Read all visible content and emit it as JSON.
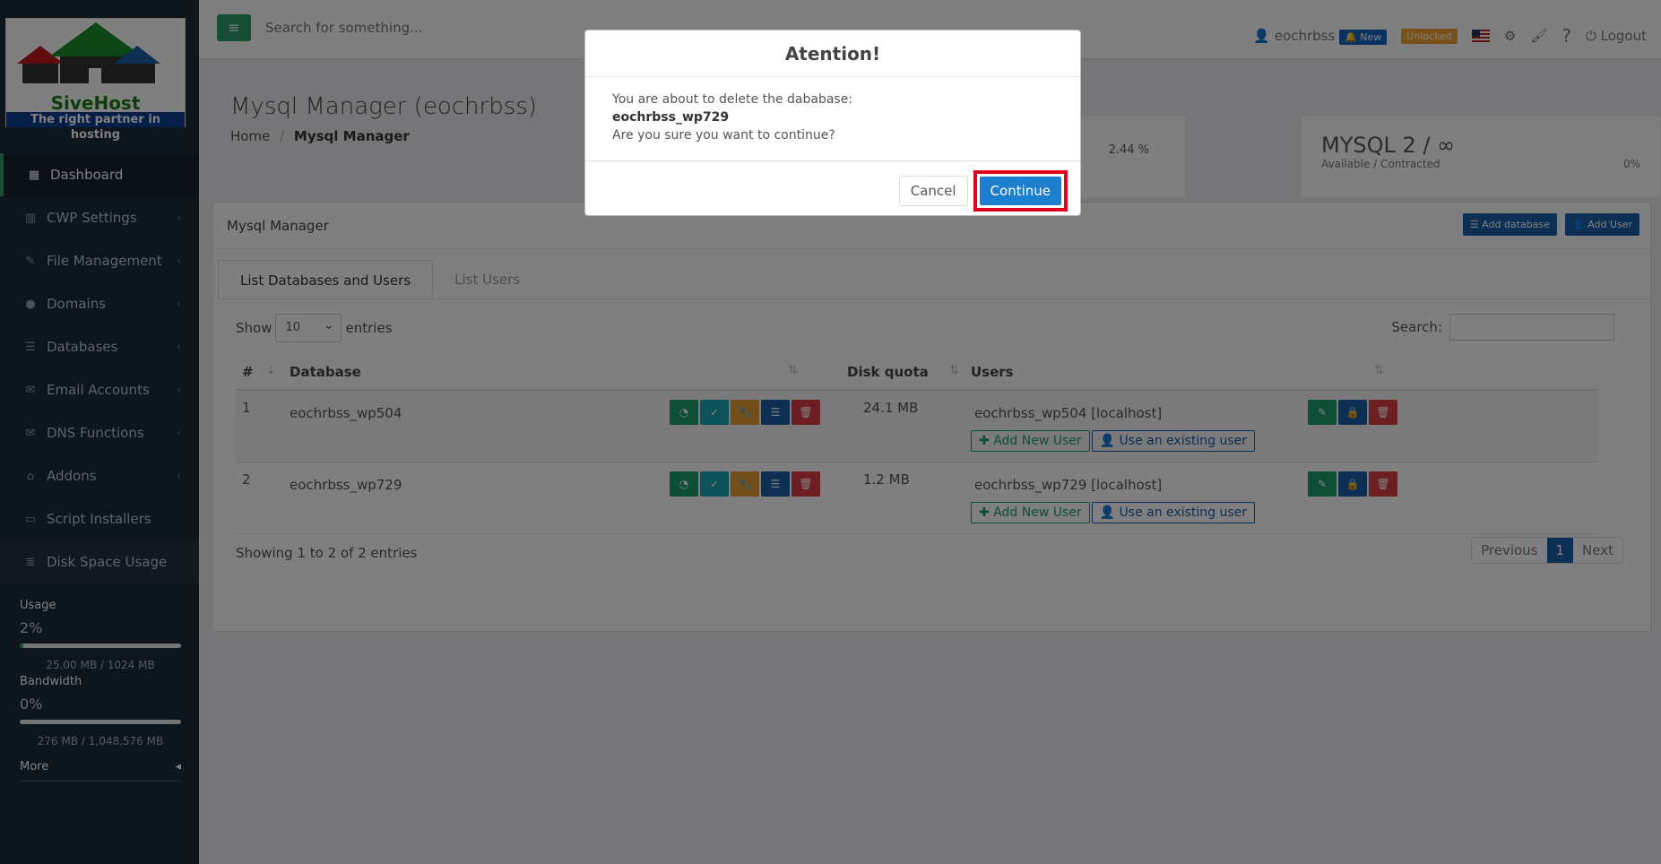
{
  "logo": {
    "brand": "SiveHost",
    "tagline": "The right partner in hosting"
  },
  "sidebar": {
    "items": [
      {
        "label": "Dashboard",
        "icon": "dashboard-icon"
      },
      {
        "label": "CWP Settings",
        "icon": "chart-icon"
      },
      {
        "label": "File Management",
        "icon": "edit-icon"
      },
      {
        "label": "Domains",
        "icon": "globe-icon"
      },
      {
        "label": "Databases",
        "icon": "database-icon"
      },
      {
        "label": "Email Accounts",
        "icon": "envelope-icon"
      },
      {
        "label": "DNS Functions",
        "icon": "envelope-icon"
      },
      {
        "label": "Addons",
        "icon": "bank-icon"
      },
      {
        "label": "Script Installers",
        "icon": "desktop-icon"
      },
      {
        "label": "Disk Space Usage",
        "icon": "list-icon"
      }
    ],
    "usage_label": "Usage",
    "usage_pct": "2%",
    "usage_detail": "25.00 MB / 1024 MB",
    "usage_fraction": 0.02,
    "bandwidth_label": "Bandwidth",
    "bandwidth_pct": "0%",
    "bandwidth_detail": "276 MB / 1,048,576 MB",
    "bandwidth_fraction": 0.0,
    "more_label": "More"
  },
  "topbar": {
    "search_placeholder": "Search for something...",
    "username": "eochrbss",
    "new_badge": "New",
    "unlocked_badge": "Unlocked",
    "logout": "Logout"
  },
  "header": {
    "title": "Mysql Manager (eochrbss)",
    "crumb_home": "Home",
    "crumb_current": "Mysql Manager",
    "prev_pct": "2.44 %",
    "mysql_big": "MYSQL 2 / ∞",
    "mysql_sub": "Available / Contracted",
    "mysql_pct": "0%"
  },
  "panel": {
    "title": "Mysql Manager",
    "add_database": "Add database",
    "add_user": "Add User",
    "tabs": [
      "List Databases and Users",
      "List Users"
    ],
    "show": "Show",
    "entries_value": "10",
    "entries": "entries",
    "search_label": "Search:",
    "columns": {
      "num": "#",
      "database": "Database",
      "disk_quota": "Disk quota",
      "users": "Users"
    },
    "rows": [
      {
        "num": "1",
        "db": "eochrbss_wp504",
        "quota": "24.1 MB",
        "user": "eochrbss_wp504 [localhost]"
      },
      {
        "num": "2",
        "db": "eochrbss_wp729",
        "quota": "1.2 MB",
        "user": "eochrbss_wp729 [localhost]"
      }
    ],
    "add_new_user": "Add New User",
    "use_existing": "Use an existing user",
    "showing": "Showing 1 to 2 of 2 entries",
    "prev": "Previous",
    "page": "1",
    "next": "Next"
  },
  "modal": {
    "title": "Atention!",
    "line1": "You are about to delete the dababase:",
    "dbname": "eochrbss_wp729",
    "line3": "Are you sure you want to continue?",
    "cancel": "Cancel",
    "continue": "Continue"
  },
  "colors": {
    "accent_green": "#2a9b6b",
    "primary_blue": "#1d5fa8",
    "highlight_red": "#e0001b"
  }
}
